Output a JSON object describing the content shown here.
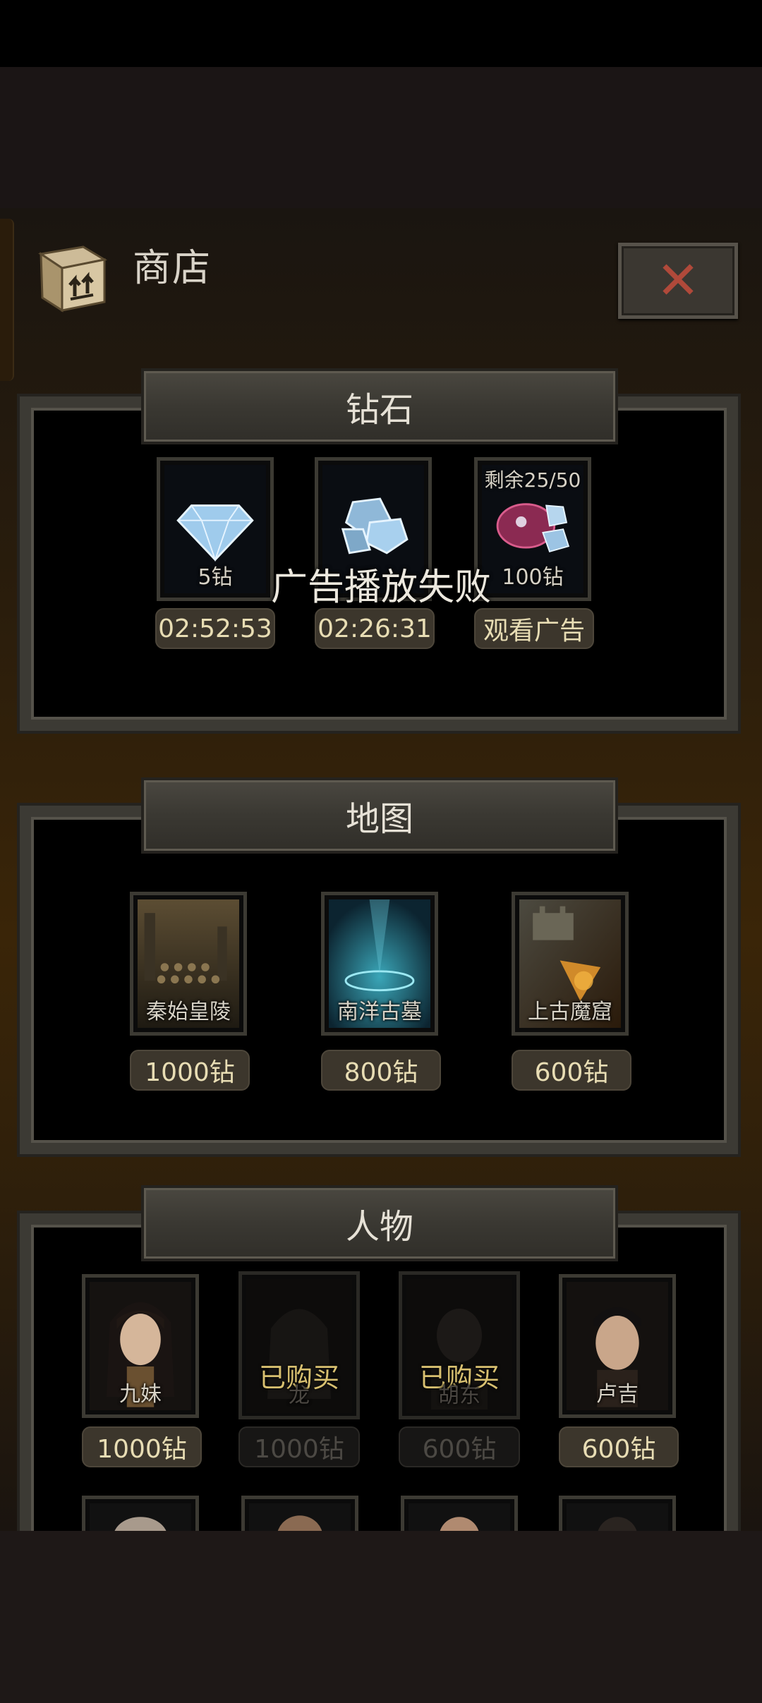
{
  "header": {
    "title": "商店",
    "close_label": "✕"
  },
  "sections": {
    "diamond": {
      "title": "钻石",
      "items": [
        {
          "caption": "5钻",
          "action": "02:52:53",
          "top": ""
        },
        {
          "caption": "",
          "action": "02:26:31",
          "top": ""
        },
        {
          "caption": "100钻",
          "action": "观看广告",
          "top": "剩余25/50"
        }
      ]
    },
    "map": {
      "title": "地图",
      "items": [
        {
          "caption": "秦始皇陵",
          "price": "1000钻"
        },
        {
          "caption": "南洋古墓",
          "price": "800钻"
        },
        {
          "caption": "上古魔窟",
          "price": "600钻"
        }
      ]
    },
    "character": {
      "title": "人物",
      "items": [
        {
          "caption": "九妹",
          "price": "1000钻",
          "status": ""
        },
        {
          "caption": "龙",
          "price": "1000钻",
          "status": "已购买"
        },
        {
          "caption": "胡东",
          "price": "600钻",
          "status": "已购买"
        },
        {
          "caption": "卢吉",
          "price": "600钻",
          "status": ""
        }
      ]
    }
  },
  "toast": "广告播放失败",
  "colors": {
    "accent_gold": "#e8ddb4",
    "close_red": "#b0493a",
    "bought_gold": "#d8c070"
  }
}
